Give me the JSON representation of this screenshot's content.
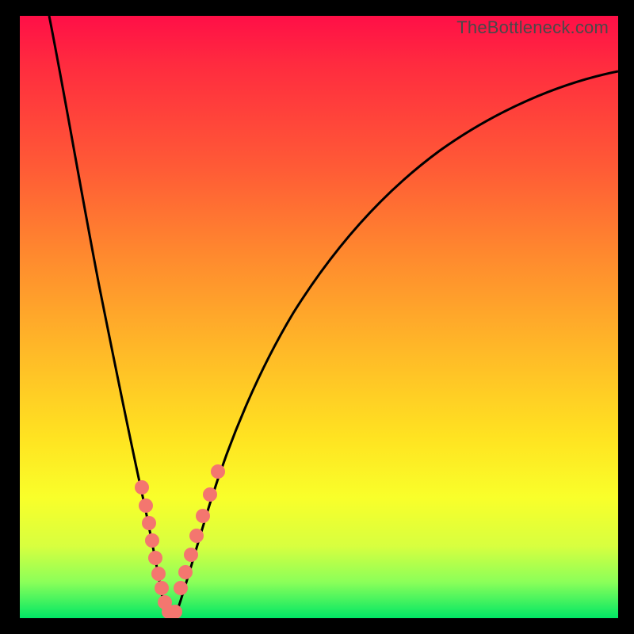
{
  "watermark": "TheBottleneck.com",
  "colors": {
    "curve": "#000000",
    "marker_fill": "#f4766f",
    "marker_stroke": "#d8504b",
    "gradient_top": "#ff0f47",
    "gradient_bottom": "#00e765"
  },
  "chart_data": {
    "type": "line",
    "title": "",
    "xlabel": "",
    "ylabel": "",
    "xlim": [
      0,
      100
    ],
    "ylim": [
      0,
      100
    ],
    "note": "Bottleneck-style V curve; y-values are percent where 0 = no bottleneck (bottom/green) and 100 = severe (top/red). Curve minimum at x≈23.",
    "curve": {
      "x": [
        0,
        3,
        6,
        9,
        12,
        15,
        18,
        20,
        22,
        23,
        24,
        26,
        28,
        31,
        35,
        40,
        46,
        53,
        61,
        70,
        80,
        90,
        100
      ],
      "y": [
        100,
        92,
        82,
        70,
        56,
        41,
        25,
        13,
        4,
        1,
        3,
        9,
        18,
        30,
        42,
        53,
        62,
        69,
        75,
        80,
        84,
        87,
        88
      ]
    },
    "series": [
      {
        "name": "markers-left",
        "x": [
          18.5,
          19.3,
          20.0,
          20.6,
          21.1,
          21.6,
          22.0,
          22.5
        ],
        "y": [
          22.0,
          18.0,
          14.0,
          10.5,
          7.5,
          5.0,
          3.0,
          2.0
        ]
      },
      {
        "name": "markers-right",
        "x": [
          25.3,
          25.9,
          26.6,
          27.4,
          28.3,
          29.3,
          30.4
        ],
        "y": [
          6.0,
          8.5,
          11.5,
          15.0,
          19.0,
          22.5,
          26.0
        ]
      }
    ]
  }
}
